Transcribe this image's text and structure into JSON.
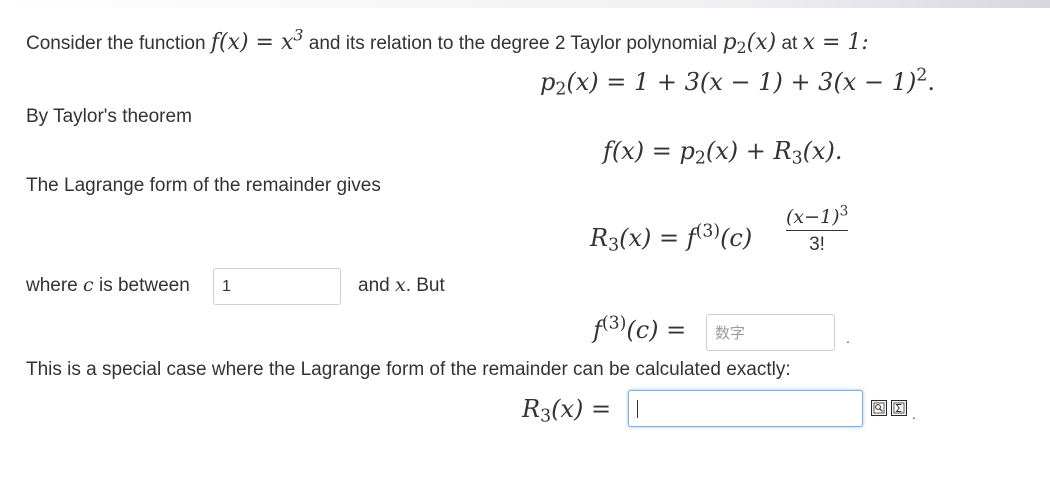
{
  "intro": {
    "lead": "Consider the function",
    "func": "f(x) = x",
    "func_exp": "3",
    "mid": "and its relation to the degree 2 Taylor polynomial",
    "poly": "p",
    "poly_sub": "2",
    "poly_arg": "(x)",
    "at": "at",
    "point": "x = 1:"
  },
  "taylor_eq": {
    "lhs": "p",
    "lhs_sub": "2",
    "body": "(x) = 1 + 3(x − 1) + 3(x − 1)",
    "exp": "2",
    "end": "."
  },
  "by_taylor": "By Taylor's theorem",
  "theorem_eq": {
    "text_a": "f(x) = p",
    "sub_a": "2",
    "text_b": "(x) + R",
    "sub_b": "3",
    "text_c": "(x)."
  },
  "lagrange_text": "The Lagrange form of the remainder gives",
  "lagrange_eq": {
    "lhs": "R",
    "lhs_sub": "3",
    "mid": "(x) = f",
    "deriv": "(3)",
    "arg": "(c)",
    "numerator": "(x−1)",
    "numerator_exp": "3",
    "denominator": "3!"
  },
  "where": {
    "before": "where",
    "var": "c",
    "is_between": "is between",
    "input_value": "1",
    "after": "and",
    "var2": "x",
    "but": ". But"
  },
  "deriv_eq": {
    "lhs": "f",
    "deriv": "(3)",
    "arg": "(c) =",
    "input_placeholder": "数字",
    "end": "."
  },
  "special_case": "This is a special case where the Lagrange form of the remainder can be calculated exactly:",
  "remainder_eq": {
    "lhs": "R",
    "lhs_sub": "3",
    "arg": "(x) =",
    "input_value": "",
    "end": "."
  },
  "icons": {
    "preview": "preview-formula-icon",
    "sigma": "sigma-formula-icon"
  }
}
